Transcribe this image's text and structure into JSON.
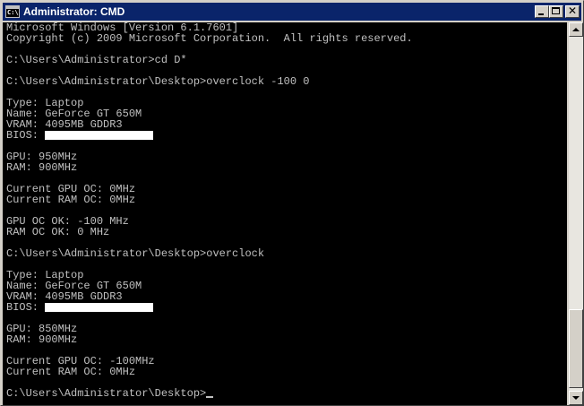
{
  "window": {
    "title": "Administrator: CMD",
    "icon": "console-icon",
    "controls": {
      "minimize": "minimize-icon",
      "maximize": "maximize-icon",
      "close": "close-icon",
      "close_glyph": "✕"
    }
  },
  "console": {
    "background": "#000000",
    "foreground": "#c0c0c0",
    "lines": [
      "Microsoft Windows [Version 6.1.7601]",
      "Copyright (c) 2009 Microsoft Corporation.  All rights reserved.",
      "",
      "C:\\Users\\Administrator>cd D*",
      "",
      "C:\\Users\\Administrator\\Desktop>overclock -100 0",
      "",
      "Type: Laptop",
      "Name: GeForce GT 650M",
      "VRAM: 4095MB GDDR3",
      "BIOS: ",
      "",
      "GPU: 950MHz",
      "RAM: 900MHz",
      "",
      "Current GPU OC: 0MHz",
      "Current RAM OC: 0MHz",
      "",
      "GPU OC OK: -100 MHz",
      "RAM OC OK: 0 MHz",
      "",
      "C:\\Users\\Administrator\\Desktop>overclock",
      "",
      "Type: Laptop",
      "Name: GeForce GT 650M",
      "VRAM: 4095MB GDDR3",
      "BIOS: ",
      "",
      "GPU: 850MHz",
      "RAM: 900MHz",
      "",
      "Current GPU OC: -100MHz",
      "Current RAM OC: 0MHz",
      "",
      "C:\\Users\\Administrator\\Desktop>"
    ],
    "redacted_lines": [
      10,
      26
    ],
    "cursor_line": 34
  }
}
